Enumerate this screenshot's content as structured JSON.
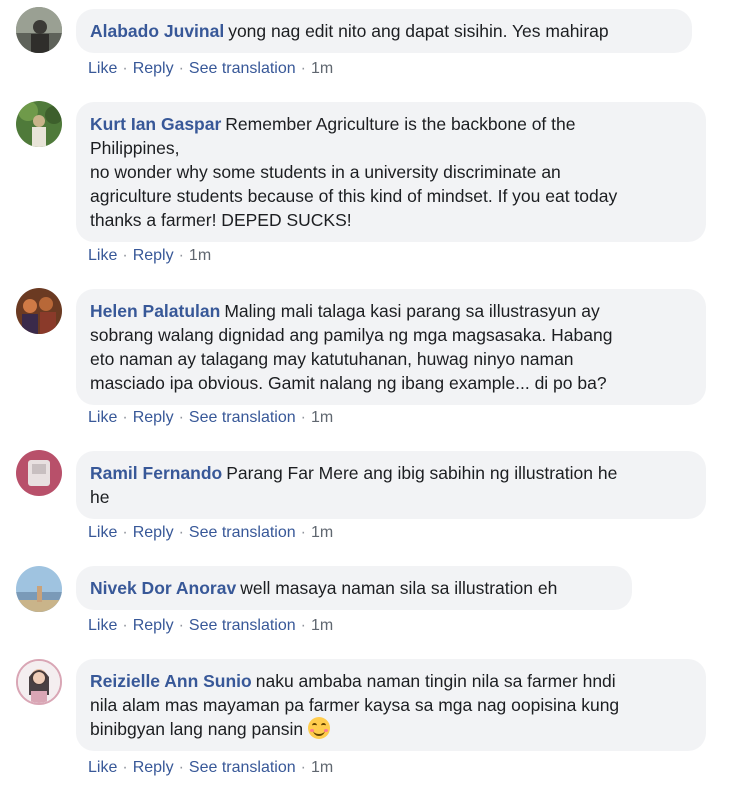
{
  "comments": [
    {
      "author": "Alabado Juvinal",
      "text": "yong nag edit nito ang dapat sisihin. Yes mahirap",
      "actions": {
        "like": "Like",
        "reply": "Reply",
        "translate": "See translation",
        "time": "1m"
      },
      "colors": {
        "bg": "#8a8f86",
        "accent": "#3b3a36"
      }
    },
    {
      "author": "Kurt Ian Gaspar",
      "text_lines": [
        "Remember Agriculture is the backbone of the",
        "Philippines,",
        "no wonder why some students in a university discriminate an",
        "agriculture students because of this kind of mindset. If you eat today",
        "thanks a farmer! DEPED SUCKS!"
      ],
      "actions": {
        "like": "Like",
        "reply": "Reply",
        "time": "1m"
      },
      "colors": {
        "bg": "#4f7a3a",
        "accent": "#c9b48a"
      }
    },
    {
      "author": "Helen Palatulan",
      "text_lines": [
        "Maling mali talaga kasi parang sa illustrasyun ay",
        "sobrang walang dignidad ang pamilya ng mga magsasaka. Habang",
        "eto naman ay talagang may katutuhanan, huwag ninyo naman",
        "masciado ipa obvious. Gamit nalang ng ibang example... di po ba?"
      ],
      "actions": {
        "like": "Like",
        "reply": "Reply",
        "translate": "See translation",
        "time": "1m"
      },
      "colors": {
        "bg": "#6b3a22",
        "accent": "#d07a46"
      }
    },
    {
      "author": "Ramil Fernando",
      "text_lines": [
        "Parang Far Mere ang ibig sabihin ng illustration he",
        "he"
      ],
      "actions": {
        "like": "Like",
        "reply": "Reply",
        "translate": "See translation",
        "time": "1m"
      },
      "colors": {
        "bg": "#b8506a",
        "accent": "#e8e0e0"
      }
    },
    {
      "author": "Nivek Dor Anorav",
      "text": "well masaya naman sila sa illustration eh",
      "actions": {
        "like": "Like",
        "reply": "Reply",
        "translate": "See translation",
        "time": "1m"
      },
      "colors": {
        "bg": "#9fc3e0",
        "accent": "#c9a27a"
      }
    },
    {
      "author": "Reizielle Ann Sunio",
      "text_lines": [
        "naku ambaba naman tingin nila sa farmer hndi",
        "nila alam mas mayaman pa farmer kaysa sa mga nag oopisina kung",
        "binibgyan lang nang pansin"
      ],
      "emoji": "smiling-face-emoji",
      "actions": {
        "like": "Like",
        "reply": "Reply",
        "translate": "See translation",
        "time": "1m"
      },
      "colors": {
        "bg": "#f4eef0",
        "accent": "#d9a6b5"
      }
    }
  ],
  "separator": "·"
}
